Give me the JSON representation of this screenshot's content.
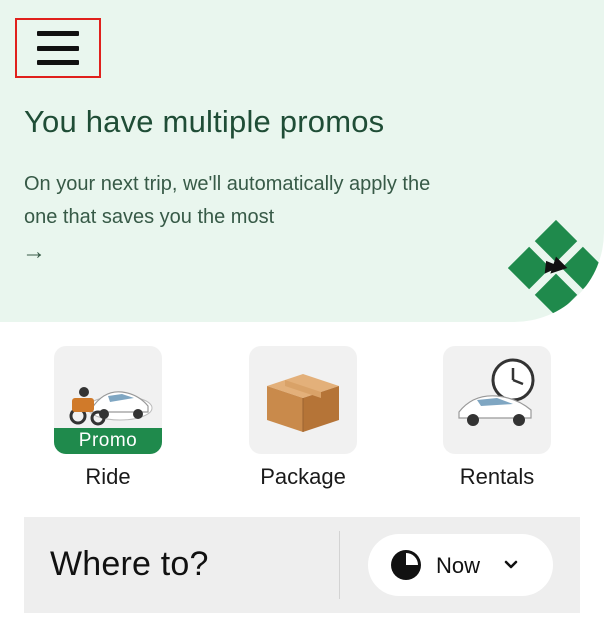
{
  "header": {
    "menu_icon": "hamburger-menu-icon"
  },
  "promo": {
    "title": "You have multiple promos",
    "description": "On your next trip, we'll automatically apply the one that saves you the most",
    "arrow": "→"
  },
  "services": [
    {
      "label": "Ride",
      "badge": "Promo",
      "icon": "car-and-bike-icon"
    },
    {
      "label": "Package",
      "icon": "package-box-icon"
    },
    {
      "label": "Rentals",
      "icon": "car-with-clock-icon"
    }
  ],
  "search": {
    "placeholder": "Where to?",
    "time_label": "Now",
    "time_icon": "clock-icon",
    "chevron_icon": "chevron-down-icon"
  },
  "colors": {
    "hero_bg": "#e9f6ee",
    "promo_green": "#1f8a4c",
    "title_green": "#1f4d36",
    "highlight_red": "#e0201c"
  }
}
